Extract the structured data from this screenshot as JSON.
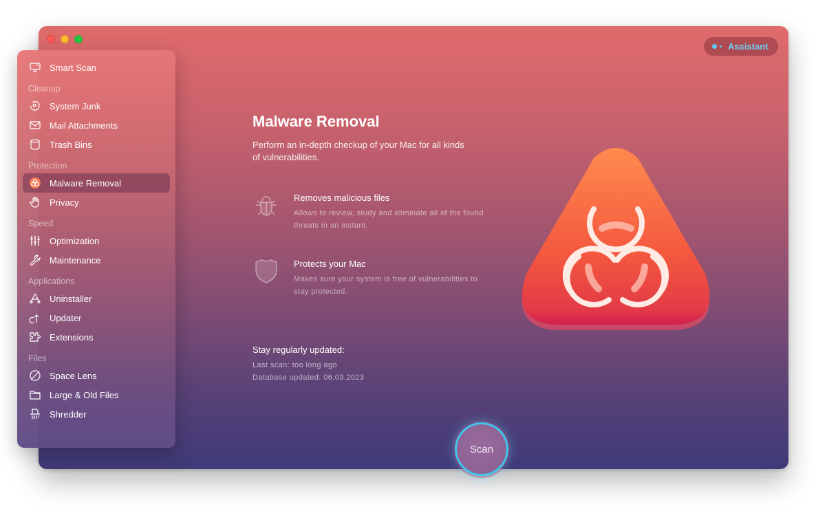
{
  "window": {
    "controls": [
      "close",
      "minimize",
      "maximize"
    ],
    "assistant_label": "Assistant"
  },
  "sidebar": {
    "top_item": {
      "label": "Smart Scan",
      "icon": "monitor-icon"
    },
    "sections": [
      {
        "label": "Cleanup",
        "items": [
          {
            "label": "System Junk",
            "icon": "disc-icon"
          },
          {
            "label": "Mail Attachments",
            "icon": "envelope-icon"
          },
          {
            "label": "Trash Bins",
            "icon": "trash-icon"
          }
        ]
      },
      {
        "label": "Protection",
        "items": [
          {
            "label": "Malware Removal",
            "icon": "biohazard-icon",
            "active": true
          },
          {
            "label": "Privacy",
            "icon": "hand-icon"
          }
        ]
      },
      {
        "label": "Speed",
        "items": [
          {
            "label": "Optimization",
            "icon": "sliders-icon"
          },
          {
            "label": "Maintenance",
            "icon": "wrench-icon"
          }
        ]
      },
      {
        "label": "Applications",
        "items": [
          {
            "label": "Uninstaller",
            "icon": "app-store-icon"
          },
          {
            "label": "Updater",
            "icon": "update-arrow-icon"
          },
          {
            "label": "Extensions",
            "icon": "puzzle-icon"
          }
        ]
      },
      {
        "label": "Files",
        "items": [
          {
            "label": "Space Lens",
            "icon": "planet-icon"
          },
          {
            "label": "Large & Old Files",
            "icon": "folder-icon"
          },
          {
            "label": "Shredder",
            "icon": "shredder-icon"
          }
        ]
      }
    ]
  },
  "main": {
    "title": "Malware Removal",
    "subtitle": "Perform an in-depth checkup of your Mac for all kinds of vulnerabilities.",
    "features": [
      {
        "icon": "bug-icon",
        "heading": "Removes malicious files",
        "description": "Allows to review, study and eliminate all of the found threats in an instant."
      },
      {
        "icon": "shield-icon",
        "heading": "Protects your Mac",
        "description": "Makes sure your system is free of vulnerabilities to stay protected."
      }
    ],
    "status": {
      "heading": "Stay regularly updated:",
      "last_scan": "Last scan: too long ago",
      "database_updated": "Database updated: 06.03.2023"
    },
    "scan_button": "Scan"
  },
  "colors": {
    "accent_ring": "#3fc7ee",
    "assistant_text": "#6fd0f5",
    "hero_top": "#ff8a4e",
    "hero_bottom": "#e0244f"
  }
}
